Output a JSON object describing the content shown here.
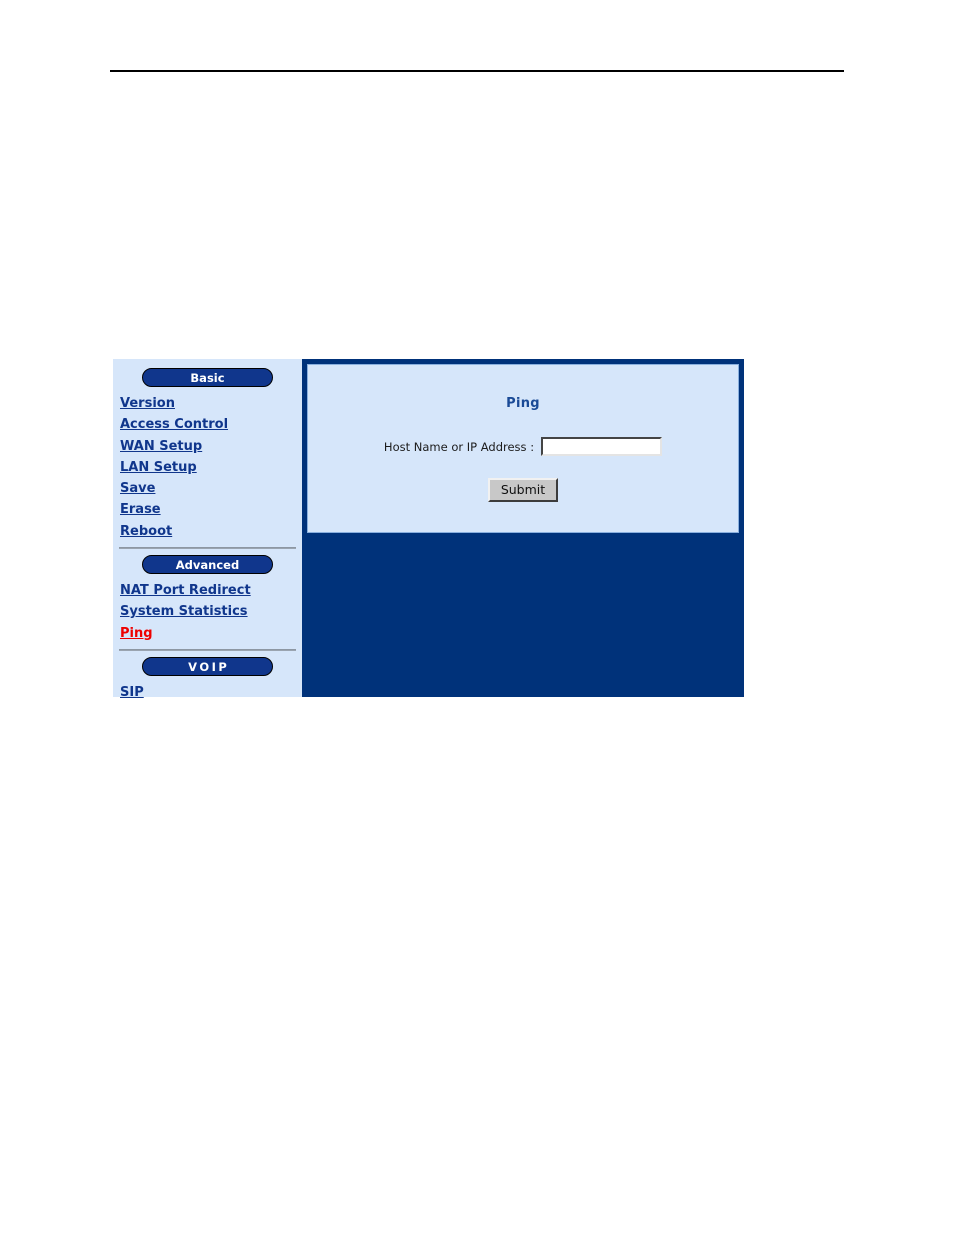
{
  "page": {
    "rule_visible": true
  },
  "colors": {
    "frame_dark_blue": "#00327a",
    "panel_light_blue": "#d6e6fa",
    "link_navy": "#10368c",
    "active_link_red": "#ee0000",
    "pill_fill": "#10368c",
    "heading_blue": "#1a4a96",
    "button_face": "#c8c8c8"
  },
  "sidebar": {
    "groups": [
      {
        "header_label": "Basic",
        "header_icon": "pill-button",
        "items": [
          {
            "label": "Version",
            "active": false
          },
          {
            "label": "Access Control",
            "active": false
          },
          {
            "label": "WAN Setup",
            "active": false
          },
          {
            "label": "LAN Setup",
            "active": false
          },
          {
            "label": "Save",
            "active": false
          },
          {
            "label": "Erase",
            "active": false
          },
          {
            "label": "Reboot",
            "active": false
          }
        ]
      },
      {
        "header_label": "Advanced",
        "header_icon": "pill-button",
        "items": [
          {
            "label": "NAT Port Redirect",
            "active": false
          },
          {
            "label": "System Statistics",
            "active": false
          },
          {
            "label": "Ping",
            "active": true
          }
        ]
      },
      {
        "header_label": "VOIP",
        "header_icon": "pill-button",
        "items": [
          {
            "label": "SIP",
            "active": false
          }
        ]
      }
    ]
  },
  "main": {
    "title": "Ping",
    "form": {
      "host_label": "Host Name or IP Address :",
      "host_value": "",
      "host_placeholder": "",
      "submit_label": "Submit"
    }
  }
}
